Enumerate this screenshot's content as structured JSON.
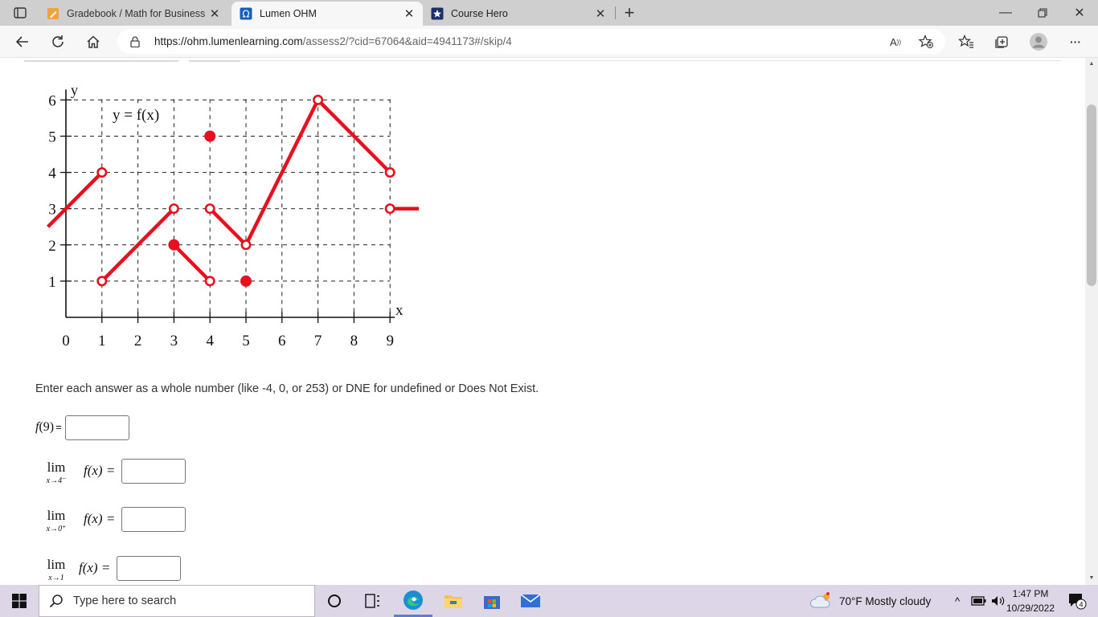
{
  "browser": {
    "tabs": [
      {
        "title": "Gradebook / Math for Business & ",
        "active": false
      },
      {
        "title": "Lumen OHM",
        "active": true
      },
      {
        "title": "Course Hero",
        "active": false
      }
    ],
    "new_tab": "+",
    "close_glyph": "✕",
    "url_host": "https://ohm.lumenlearning.com",
    "url_path": "/assess2/?cid=67064&aid=4941173#/skip/4",
    "read_aloud": "A",
    "window_minimize": "—",
    "window_close": "✕",
    "more_glyph": "···"
  },
  "graph": {
    "function_label": "y = f(x)",
    "y_axis_label": "y",
    "x_axis_label": "x",
    "x_ticks": [
      "0",
      "1",
      "2",
      "3",
      "4",
      "5",
      "6",
      "7",
      "8",
      "9"
    ],
    "y_ticks": [
      "1",
      "2",
      "3",
      "4",
      "5",
      "6"
    ],
    "color": "#e8101f"
  },
  "chart_data": {
    "type": "line",
    "title": "y = f(x)",
    "xlabel": "x",
    "ylabel": "y",
    "xlim": [
      0,
      9
    ],
    "ylim": [
      0,
      6
    ],
    "grid": true,
    "segments": [
      {
        "x": [
          -0.5,
          1
        ],
        "y": [
          2.5,
          4
        ]
      },
      {
        "x": [
          1,
          3
        ],
        "y": [
          1,
          3
        ]
      },
      {
        "x": [
          3,
          4
        ],
        "y": [
          2,
          1
        ]
      },
      {
        "x": [
          4,
          5
        ],
        "y": [
          3,
          2
        ]
      },
      {
        "x": [
          5,
          7
        ],
        "y": [
          2,
          6
        ]
      },
      {
        "x": [
          7,
          9
        ],
        "y": [
          6,
          4
        ]
      },
      {
        "x": [
          9,
          9.8
        ],
        "y": [
          3,
          3
        ]
      }
    ],
    "open_points": [
      [
        1,
        4
      ],
      [
        1,
        1
      ],
      [
        3,
        3
      ],
      [
        4,
        3
      ],
      [
        4,
        1
      ],
      [
        5,
        2
      ],
      [
        7,
        6
      ],
      [
        9,
        4
      ],
      [
        9,
        3
      ]
    ],
    "closed_points": [
      [
        4,
        5
      ],
      [
        3,
        2
      ],
      [
        5,
        1
      ]
    ]
  },
  "question": {
    "instruction": "Enter each answer as a whole number (like -4, 0, or 253) or DNE for undefined or Does Not Exist.",
    "q1": {
      "f": "f",
      "arg": "(9)",
      "eq": "="
    },
    "lim": "lim",
    "q2": {
      "sub": "x→4⁻",
      "expr": "f(x) ="
    },
    "q3": {
      "sub": "x→0⁺",
      "expr": "f(x) ="
    },
    "q4": {
      "sub": "x→1",
      "expr": "f(x) ="
    }
  },
  "taskbar": {
    "search_placeholder": "Type here to search",
    "weather": "70°F  Mostly cloudy",
    "time": "1:47 PM",
    "date": "10/29/2022",
    "notification_count": "4"
  }
}
